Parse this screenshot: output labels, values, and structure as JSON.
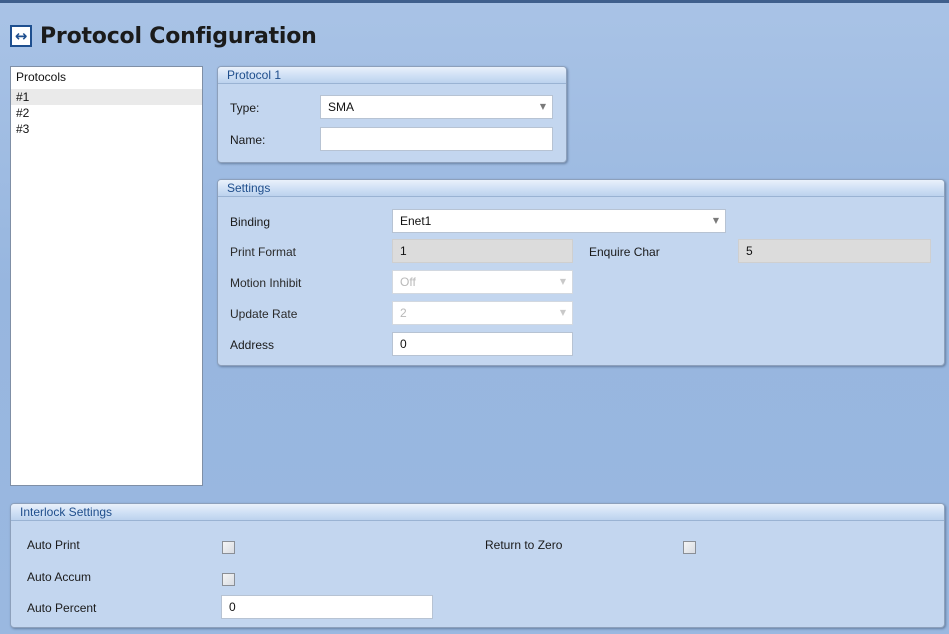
{
  "title": "Protocol Configuration",
  "title_icon": "swap-horizontal-icon",
  "protocols": {
    "header": "Protocols",
    "items": [
      "#1",
      "#2",
      "#3"
    ],
    "selected": "#1"
  },
  "protocol_group": {
    "title": "Protocol 1",
    "type_label": "Type:",
    "type_value": "SMA",
    "name_label": "Name:",
    "name_value": ""
  },
  "settings_group": {
    "title": "Settings",
    "binding_label": "Binding",
    "binding_value": "Enet1",
    "print_format_label": "Print Format",
    "print_format_value": "1",
    "enquire_char_label": "Enquire Char",
    "enquire_char_value": "5",
    "motion_inhibit_label": "Motion Inhibit",
    "motion_inhibit_value": "Off",
    "update_rate_label": "Update Rate",
    "update_rate_value": "2",
    "address_label": "Address",
    "address_value": "0"
  },
  "interlock_group": {
    "title": "Interlock Settings",
    "auto_print_label": "Auto Print",
    "auto_print_checked": false,
    "return_to_zero_label": "Return to Zero",
    "return_to_zero_checked": false,
    "auto_accum_label": "Auto Accum",
    "auto_accum_checked": false,
    "auto_percent_label": "Auto Percent",
    "auto_percent_value": "0"
  },
  "colors": {
    "background": "#9ab8e0",
    "group_header_text": "#1f4e8c",
    "readonly_field": "#dcdcdc"
  }
}
